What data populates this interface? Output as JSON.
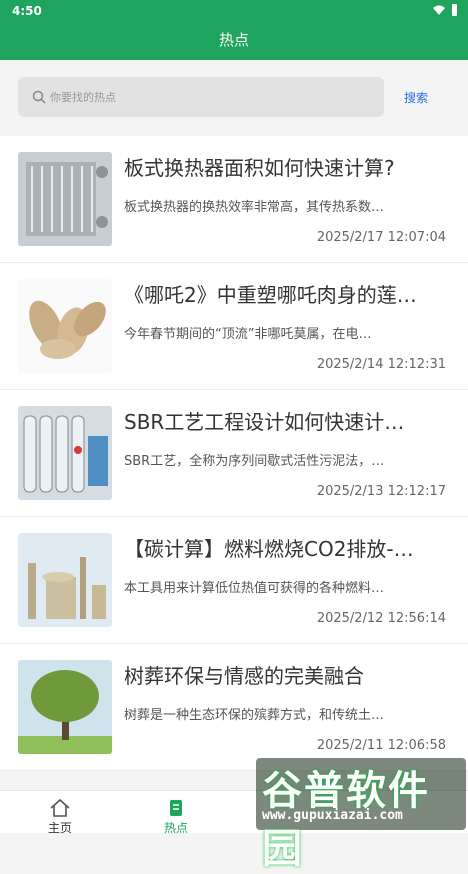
{
  "status": {
    "time": "4:50"
  },
  "header": {
    "title": "热点"
  },
  "search": {
    "placeholder": "你要找的热点",
    "button": "搜索"
  },
  "articles": [
    {
      "title": "板式换热器面积如何快速计算?",
      "desc": "板式换热器的换热效率非常高，其传热系数…",
      "date": "2025/2/17 12:07:04",
      "thumb": "heat-exchanger"
    },
    {
      "title": "《哪吒2》中重塑哪吒肉身的莲…",
      "desc": "今年春节期间的“顶流”非哪吒莫属，在电…",
      "date": "2025/2/14 12:12:31",
      "thumb": "lotus-root"
    },
    {
      "title": "SBR工艺工程设计如何快速计…",
      "desc": "SBR工艺，全称为序列间歇式活性污泥法，…",
      "date": "2025/2/13 12:12:17",
      "thumb": "water-plant"
    },
    {
      "title": "【碳计算】燃料燃烧CO2排放-…",
      "desc": "本工具用来计算低位热值可获得的各种燃料…",
      "date": "2025/2/12 12:56:14",
      "thumb": "refinery"
    },
    {
      "title": "树葬环保与情感的完美融合",
      "desc": "树葬是一种生态环保的殡葬方式，和传统土…",
      "date": "2025/2/11 12:06:58",
      "thumb": "tree"
    }
  ],
  "tabs": [
    {
      "label": "主页",
      "icon": "home-icon"
    },
    {
      "label": "热点",
      "icon": "hot-icon"
    }
  ],
  "watermark": {
    "big": "谷普软件园",
    "small": "www.gupuxiazai.com"
  },
  "colors": {
    "brand": "#1ea45c",
    "link": "#2a6fe0"
  }
}
